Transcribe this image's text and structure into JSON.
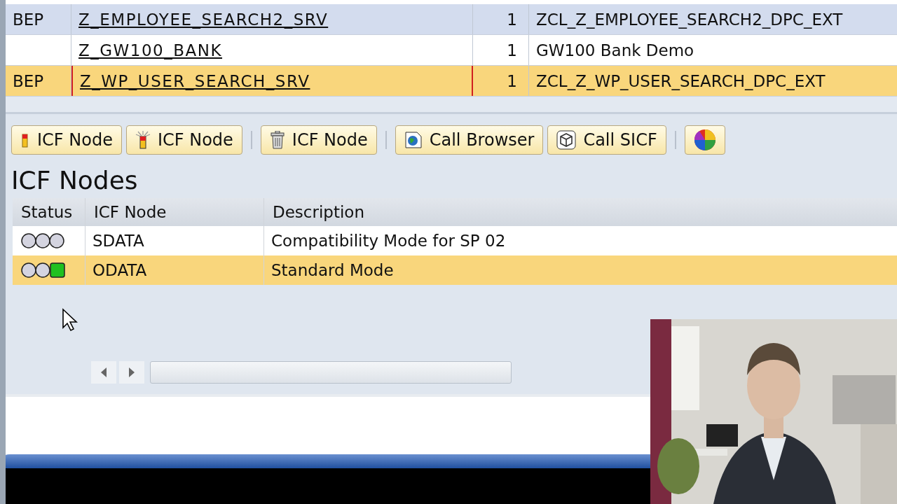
{
  "services": {
    "rows": [
      {
        "column_1": "BEP",
        "service": "Z_EMPLOYEE_SEARCH2_SRV",
        "version": "1",
        "class": "ZCL_Z_EMPLOYEE_SEARCH2_DPC_EXT",
        "selected": false,
        "focused": false
      },
      {
        "column_1": "",
        "service": "Z_GW100_BANK",
        "version": "1",
        "class": "GW100 Bank Demo",
        "selected": false,
        "focused": false
      },
      {
        "column_1": "BEP",
        "service": "Z_WP_USER_SEARCH_SRV",
        "version": "1",
        "class": "ZCL_Z_WP_USER_SEARCH_DPC_EXT",
        "selected": true,
        "focused": true
      }
    ]
  },
  "toolbar": [
    {
      "kind": "create",
      "label": "ICF Node"
    },
    {
      "kind": "activate",
      "label": "ICF Node"
    },
    {
      "kind": "delete",
      "label": "ICF Node"
    },
    {
      "kind": "browser",
      "label": "Call Browser"
    },
    {
      "kind": "sicf",
      "label": "Call SICF"
    },
    {
      "kind": "colors"
    }
  ],
  "icf_nodes": {
    "title": "ICF Nodes",
    "columns": [
      "Status",
      "ICF Node",
      "Description"
    ],
    "rows": [
      {
        "active": false,
        "node": "SDATA",
        "description": "Compatibility Mode for SP 02",
        "selected": false
      },
      {
        "active": true,
        "node": "ODATA",
        "description": "Standard Mode",
        "selected": true
      }
    ]
  }
}
